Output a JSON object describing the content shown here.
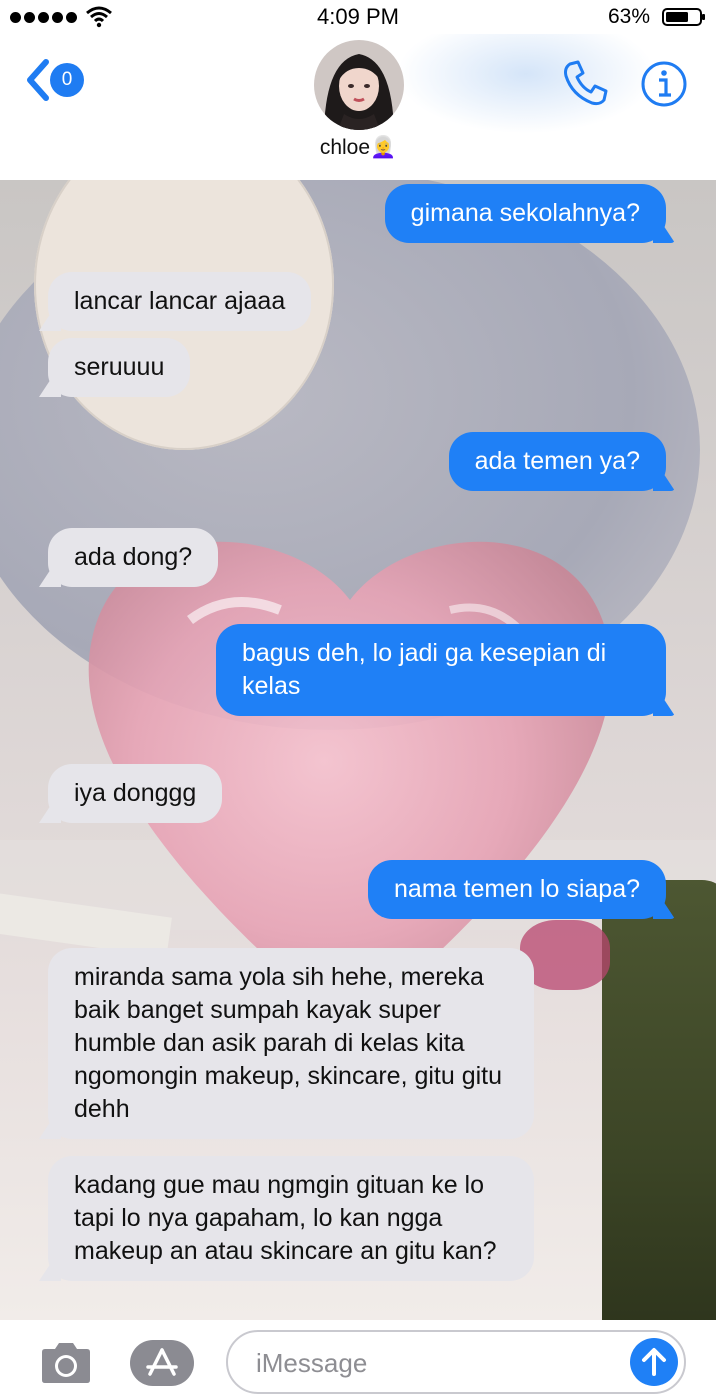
{
  "status_bar": {
    "time": "4:09 PM",
    "battery_percent": "63%"
  },
  "header": {
    "back_count": "0",
    "contact_name": "chloe👩‍🦳"
  },
  "messages": [
    {
      "direction": "outgoing",
      "text": "gimana sekolahnya?"
    },
    {
      "direction": "incoming",
      "text": "lancar lancar ajaaa"
    },
    {
      "direction": "incoming",
      "text": "seruuuu"
    },
    {
      "direction": "outgoing",
      "text": "ada temen ya?"
    },
    {
      "direction": "incoming",
      "text": "ada dong?"
    },
    {
      "direction": "outgoing",
      "text": "bagus deh, lo jadi ga kesepian di kelas"
    },
    {
      "direction": "incoming",
      "text": "iya donggg"
    },
    {
      "direction": "outgoing",
      "text": "nama temen lo siapa?"
    },
    {
      "direction": "incoming",
      "text": "miranda sama yola sih hehe, mereka baik banget sumpah kayak super humble dan asik parah di kelas kita ngomongin makeup, skincare, gitu gitu dehh"
    },
    {
      "direction": "incoming",
      "text": "kadang gue mau ngmgin gituan ke lo tapi lo nya gapaham, lo kan ngga makeup an atau skincare an gitu kan?"
    }
  ],
  "composer": {
    "placeholder": "iMessage"
  },
  "colors": {
    "accent": "#1f80f6",
    "incoming_bubble": "#e6e5ea"
  },
  "icons": [
    "back-chevron-icon",
    "phone-icon",
    "info-icon",
    "camera-icon",
    "app-store-icon",
    "send-arrow-icon"
  ]
}
